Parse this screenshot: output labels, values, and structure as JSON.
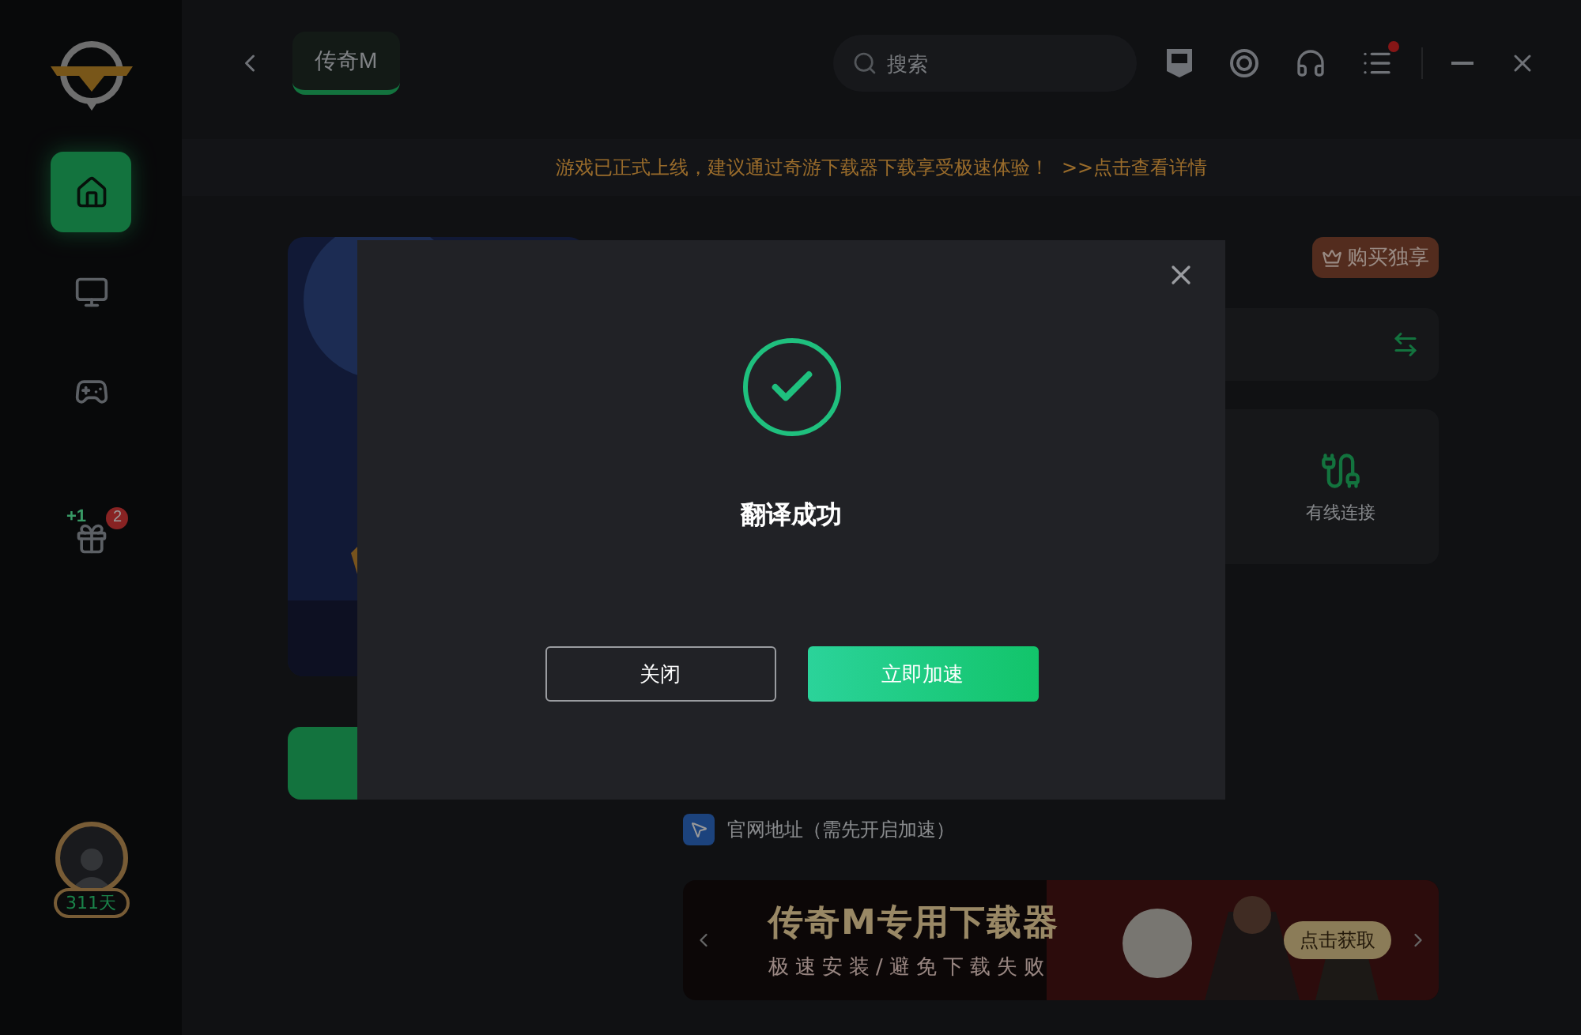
{
  "sidebar": {
    "items": [
      {
        "kind": "home",
        "selected": true
      },
      {
        "kind": "monitor",
        "selected": false
      },
      {
        "kind": "gamepad",
        "selected": false
      },
      {
        "kind": "gift",
        "selected": false,
        "badge": "2",
        "tag": "+1"
      }
    ],
    "profile": {
      "days": "311天"
    }
  },
  "topbar": {
    "tab": {
      "label": "传奇M",
      "selected": true
    },
    "search": {
      "placeholder": "搜索"
    },
    "menu_notification": true
  },
  "notice": {
    "text": "游戏已正式上线，建议通过奇游下载器下载享受极速体验！",
    "link": ">>点击查看详情"
  },
  "game": {
    "purchase_badge": "购买独享",
    "connection": {
      "label": "有线连接"
    },
    "website": "官网地址（需先开启加速）",
    "banner": {
      "title": "传奇M专用下载器",
      "subtitle": "极速安装/避免下载失败",
      "button": "点击获取"
    }
  },
  "dialog": {
    "title": "翻译成功",
    "buttons": [
      {
        "label": "关闭",
        "kind": "secondary"
      },
      {
        "label": "立即加速",
        "kind": "primary"
      }
    ]
  }
}
